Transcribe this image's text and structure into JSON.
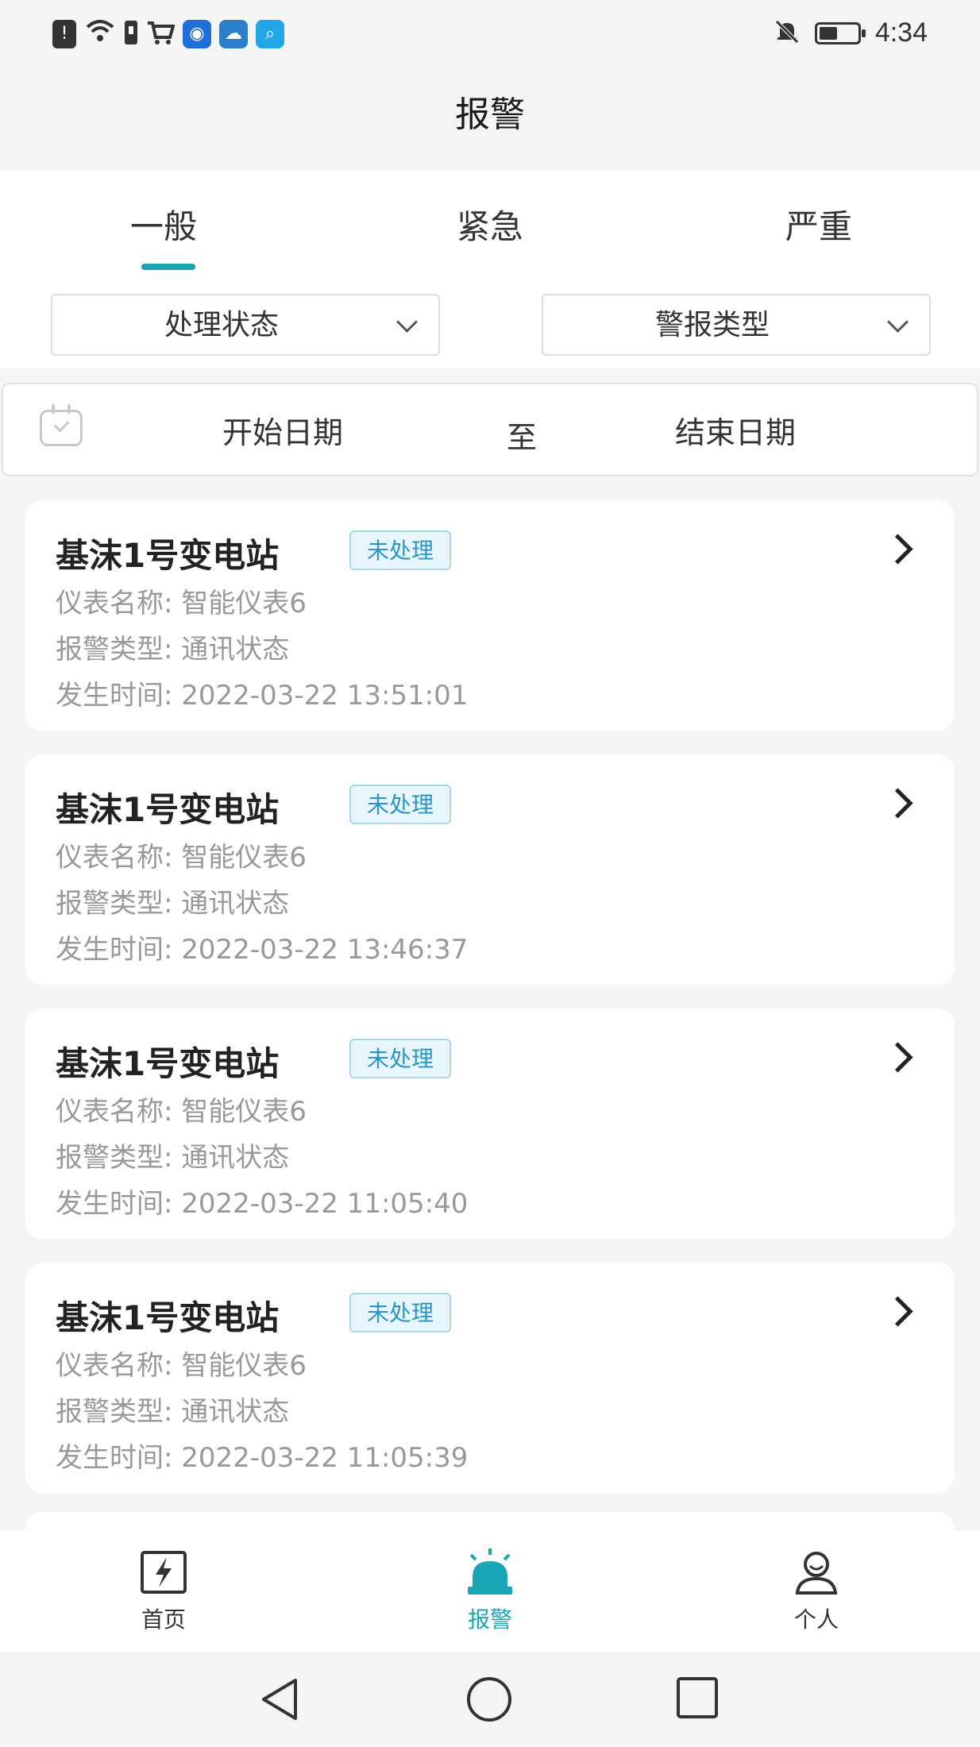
{
  "status_bar": {
    "time": "4:34",
    "icons": [
      "alert-icon",
      "wifi-icon",
      "sim-icon",
      "cart-icon",
      "bulb-app-icon",
      "cloud-app-icon",
      "search-app-icon",
      "mute-bell-icon",
      "battery-icon"
    ]
  },
  "header": {
    "title": "报警"
  },
  "tabs": [
    {
      "label": "一般",
      "active": true
    },
    {
      "label": "紧急",
      "active": false
    },
    {
      "label": "严重",
      "active": false
    }
  ],
  "filters": {
    "status_select": "处理状态",
    "type_select": "警报类型"
  },
  "date_range": {
    "start_placeholder": "开始日期",
    "separator": "至",
    "end_placeholder": "结束日期"
  },
  "alarms": [
    {
      "station": "基沫1号变电站",
      "badge": "未处理",
      "meter_label": "仪表名称:",
      "meter": "智能仪表6",
      "type_label": "报警类型:",
      "type": "通讯状态",
      "time_label": "发生时间:",
      "time": "2022-03-22 13:51:01"
    },
    {
      "station": "基沫1号变电站",
      "badge": "未处理",
      "meter_label": "仪表名称:",
      "meter": "智能仪表6",
      "type_label": "报警类型:",
      "type": "通讯状态",
      "time_label": "发生时间:",
      "time": "2022-03-22 13:46:37"
    },
    {
      "station": "基沫1号变电站",
      "badge": "未处理",
      "meter_label": "仪表名称:",
      "meter": "智能仪表6",
      "type_label": "报警类型:",
      "type": "通讯状态",
      "time_label": "发生时间:",
      "time": "2022-03-22 11:05:40"
    },
    {
      "station": "基沫1号变电站",
      "badge": "未处理",
      "meter_label": "仪表名称:",
      "meter": "智能仪表6",
      "type_label": "报警类型:",
      "type": "通讯状态",
      "time_label": "发生时间:",
      "time": "2022-03-22 11:05:39"
    }
  ],
  "bottom_nav": [
    {
      "label": "首页",
      "icon": "home-bolt-icon",
      "active": false
    },
    {
      "label": "报警",
      "icon": "siren-icon",
      "active": true
    },
    {
      "label": "个人",
      "icon": "person-icon",
      "active": false
    }
  ],
  "colors": {
    "accent": "#1aa5b4",
    "badge_text": "#2a96c4",
    "badge_bg": "#e8f5fb"
  }
}
